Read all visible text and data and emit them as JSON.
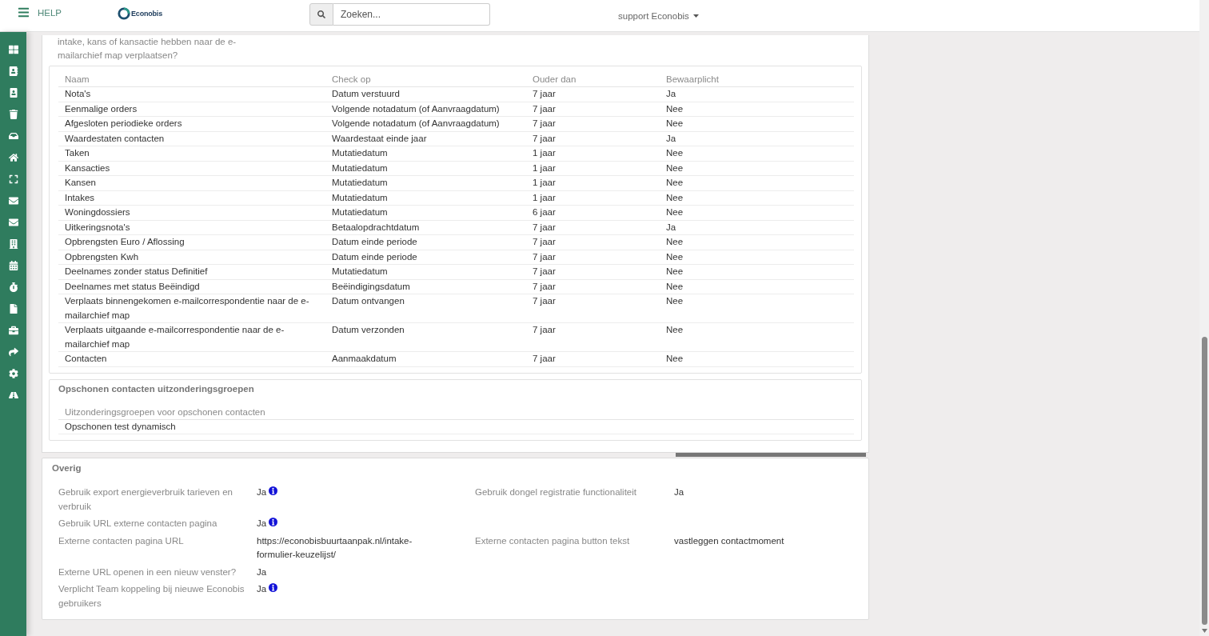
{
  "header": {
    "help_label": "HELP",
    "logo_text": "Econobis",
    "search": {
      "placeholder": "Zoeken..."
    },
    "user_menu": "support Econobis"
  },
  "cleanup": {
    "question": "intake, kans of kansactie hebben naar de e-mailarchief map verplaatsen?",
    "table": {
      "columns": [
        "Naam",
        "Check op",
        "Ouder dan",
        "Bewaarplicht"
      ],
      "rows": [
        [
          "Nota's",
          "Datum verstuurd",
          "7 jaar",
          "Ja"
        ],
        [
          "Eenmalige orders",
          "Volgende notadatum (of Aanvraagdatum)",
          "7 jaar",
          "Nee"
        ],
        [
          "Afgesloten periodieke orders",
          "Volgende notadatum (of Aanvraagdatum)",
          "7 jaar",
          "Nee"
        ],
        [
          "Waardestaten contacten",
          "Waardestaat einde jaar",
          "7 jaar",
          "Ja"
        ],
        [
          "Taken",
          "Mutatiedatum",
          "1 jaar",
          "Nee"
        ],
        [
          "Kansacties",
          "Mutatiedatum",
          "1 jaar",
          "Nee"
        ],
        [
          "Kansen",
          "Mutatiedatum",
          "1 jaar",
          "Nee"
        ],
        [
          "Intakes",
          "Mutatiedatum",
          "1 jaar",
          "Nee"
        ],
        [
          "Woningdossiers",
          "Mutatiedatum",
          "6 jaar",
          "Nee"
        ],
        [
          "Uitkeringsnota's",
          "Betaalopdrachtdatum",
          "7 jaar",
          "Ja"
        ],
        [
          "Opbrengsten Euro / Aflossing",
          "Datum einde periode",
          "7 jaar",
          "Nee"
        ],
        [
          "Opbrengsten Kwh",
          "Datum einde periode",
          "7 jaar",
          "Nee"
        ],
        [
          "Deelnames zonder status Definitief",
          "Mutatiedatum",
          "7 jaar",
          "Nee"
        ],
        [
          "Deelnames met status Beëindigd",
          "Beëindigingsdatum",
          "7 jaar",
          "Nee"
        ],
        [
          "Verplaats binnengekomen e-mailcorrespondentie naar de e-mailarchief map",
          "Datum ontvangen",
          "7 jaar",
          "Nee"
        ],
        [
          "Verplaats uitgaande e-mailcorrespondentie naar de e-mailarchief map",
          "Datum verzonden",
          "7 jaar",
          "Nee"
        ],
        [
          "Contacten",
          "Aanmaakdatum",
          "7 jaar",
          "Nee"
        ]
      ]
    }
  },
  "exceptions": {
    "title": "Opschonen contacten uitzonderingsgroepen",
    "table": {
      "columns": [
        "Uitzonderingsgroepen voor opschonen contacten"
      ],
      "rows": [
        [
          "Opschonen test dynamisch"
        ]
      ]
    }
  },
  "overig": {
    "title": "Overig",
    "rows": [
      {
        "left": {
          "label": "Gebruik export energieverbruik tarieven en verbruik",
          "value": "Ja",
          "info": true
        },
        "right": {
          "label": "Gebruik dongel registratie functionaliteit",
          "value": "Ja",
          "info": false
        }
      },
      {
        "left": {
          "label": "Gebruik URL externe contacten pagina",
          "value": "Ja",
          "info": true
        }
      },
      {
        "left": {
          "label": "Externe contacten pagina URL",
          "value": "https://econobisbuurtaanpak.nl/intake-formulier-keuzelijst/",
          "info": false
        },
        "right": {
          "label": "Externe contacten pagina button tekst",
          "value": "vastleggen contactmoment",
          "info": false
        }
      },
      {
        "left": {
          "label": "Externe URL openen in een nieuw venster?",
          "value": "Ja",
          "info": false
        }
      },
      {
        "left": {
          "label": "Verplicht Team koppeling bij nieuwe Econobis gebruikers",
          "value": "Ja",
          "info": true
        }
      }
    ]
  }
}
